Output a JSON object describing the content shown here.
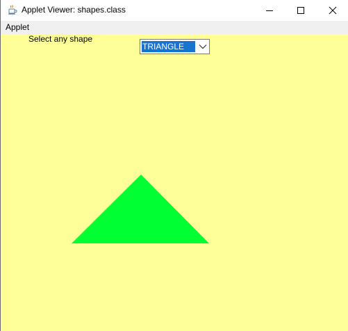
{
  "window": {
    "title": "Applet Viewer: shapes.class",
    "icon": "java-coffee-cup-icon"
  },
  "menubar": {
    "items": [
      {
        "label": "Applet"
      }
    ]
  },
  "applet": {
    "prompt_label": "Select any shape",
    "shape_select": {
      "selected_value": "TRIANGLE"
    },
    "background_color": "#ffff99",
    "shape": {
      "type": "triangle",
      "fill_color": "#00ff33"
    }
  },
  "colors": {
    "selection_highlight": "#1874cd",
    "shape_fill": "#00ff33",
    "applet_background": "#ffff99"
  }
}
